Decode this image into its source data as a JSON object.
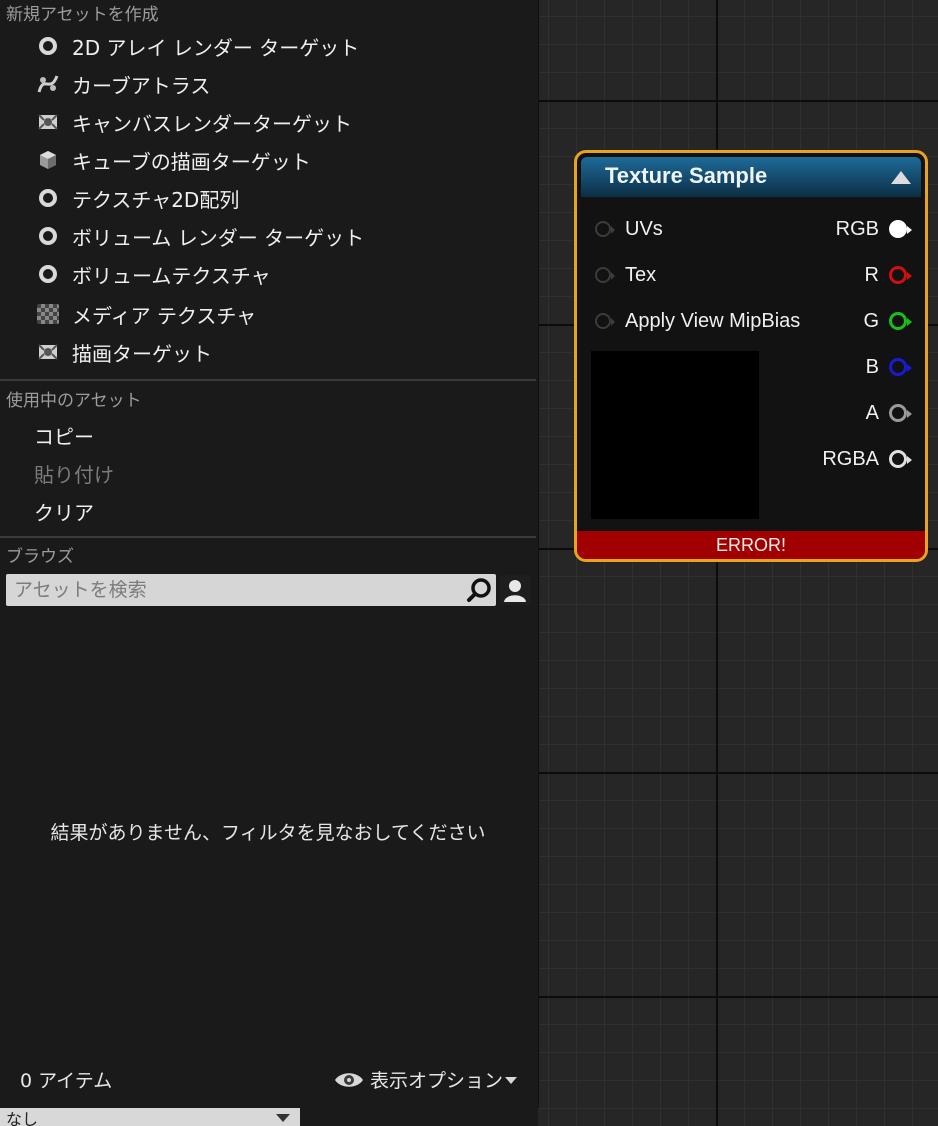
{
  "menu": {
    "create_header": "新規アセットを作成",
    "create_items": [
      {
        "label": "2D アレイ レンダー ターゲット",
        "icon": "ring-icon"
      },
      {
        "label": "カーブアトラス",
        "icon": "curve-atlas-icon"
      },
      {
        "label": "キャンバスレンダーターゲット",
        "icon": "canvas-render-target-icon"
      },
      {
        "label": "キューブの描画ターゲット",
        "icon": "cube-icon"
      },
      {
        "label": "テクスチャ2D配列",
        "icon": "ring-icon"
      },
      {
        "label": "ボリューム レンダー ターゲット",
        "icon": "ring-icon"
      },
      {
        "label": "ボリュームテクスチャ",
        "icon": "ring-icon"
      },
      {
        "label": "メディア テクスチャ",
        "icon": "media-texture-icon"
      },
      {
        "label": "描画ターゲット",
        "icon": "render-target-icon"
      }
    ],
    "current_header": "使用中のアセット",
    "copy_label": "コピー",
    "paste_label": "貼り付け",
    "clear_label": "クリア",
    "browse_header": "ブラウズ",
    "search_placeholder": "アセットを検索",
    "empty_message": "結果がありません、フィルタを見なおしてください",
    "item_count": "0 アイテム",
    "view_options": "表示オプション",
    "bottom_dropdown": "なし"
  },
  "node": {
    "title": "Texture Sample",
    "inputs": [
      "UVs",
      "Tex",
      "Apply View MipBias"
    ],
    "outputs": [
      {
        "label": "RGB",
        "color": "#ffffff"
      },
      {
        "label": "R",
        "color": "#d01010"
      },
      {
        "label": "G",
        "color": "#18c018"
      },
      {
        "label": "B",
        "color": "#1a1ad6"
      },
      {
        "label": "A",
        "color": "#9a9a9a"
      },
      {
        "label": "RGBA",
        "color": "#e0e0e0"
      }
    ],
    "error_text": "ERROR!",
    "header_color": "#1e6b99",
    "border_color": "#e7a41f",
    "error_color": "#a10000"
  }
}
